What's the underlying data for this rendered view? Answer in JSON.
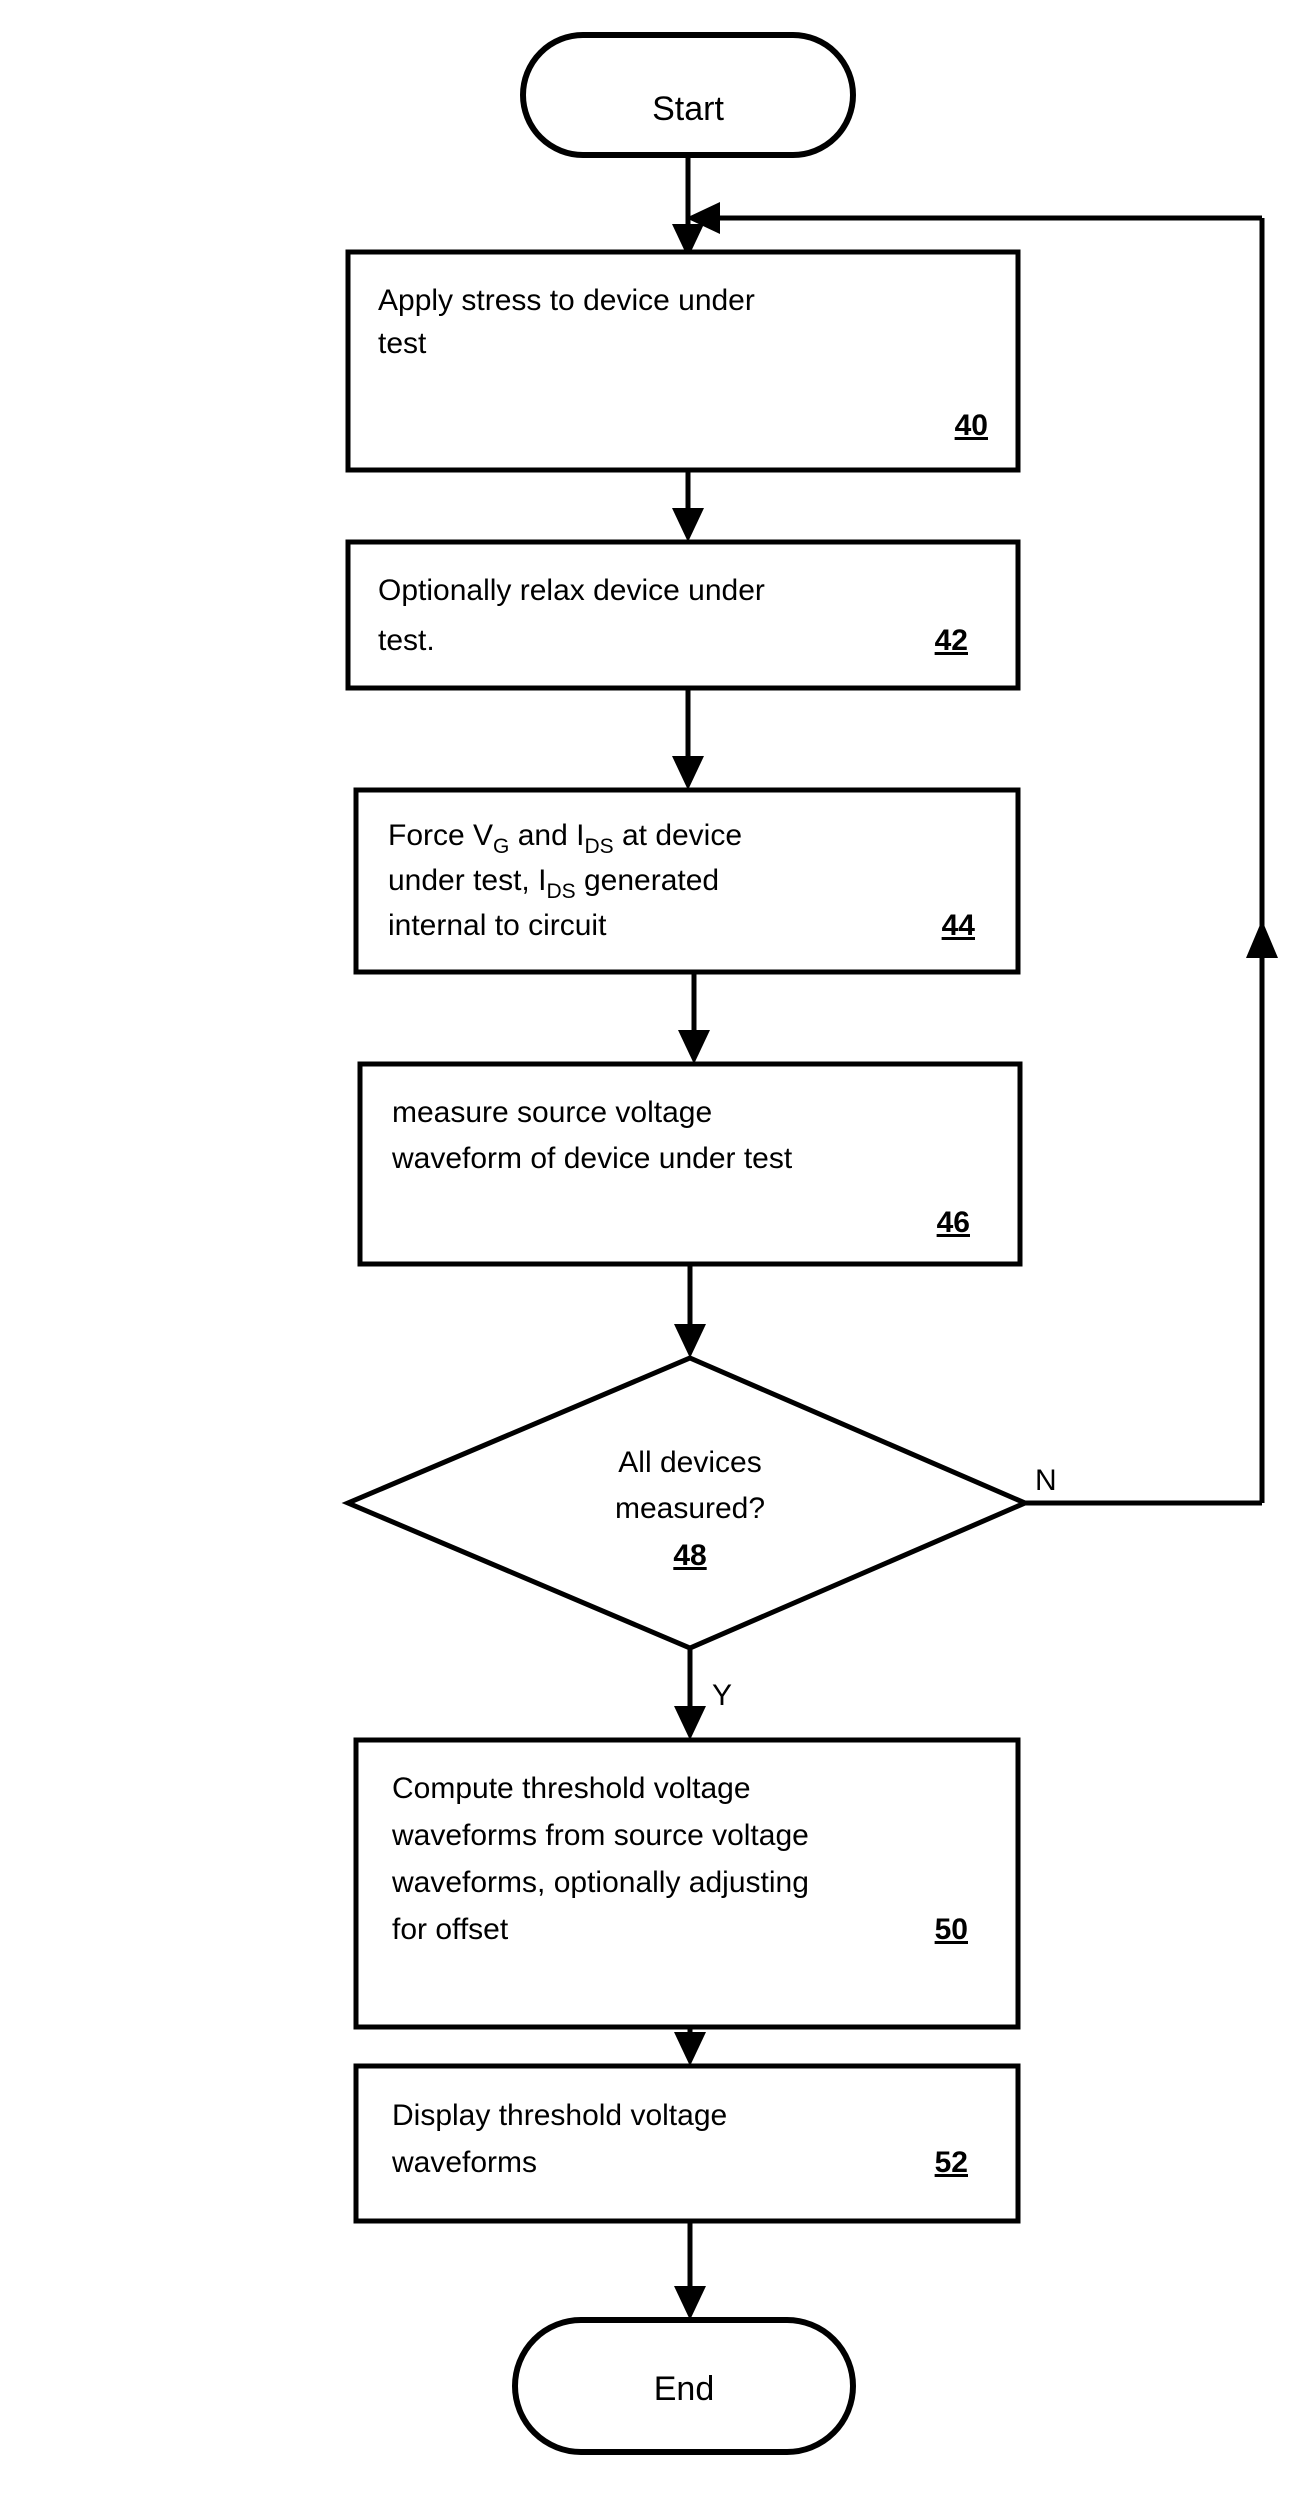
{
  "diagram": {
    "title": "Threshold voltage waveform measurement flowchart",
    "colors": {
      "stroke": "#000000",
      "fill": "#ffffff",
      "background": "#ffffff"
    },
    "start": {
      "label": "Start"
    },
    "end": {
      "label": "End"
    },
    "steps": [
      {
        "ref": "40",
        "lines": [
          "Apply stress to device under",
          "test"
        ],
        "line1": "Apply stress to device under",
        "line2": "test",
        "line3": "",
        "line4": "",
        "full_text": "Apply stress to device under test"
      },
      {
        "ref": "42",
        "lines": [
          "Optionally relax device under",
          "test."
        ],
        "line1": "Optionally relax device under",
        "line2": "test.",
        "line3": "",
        "line4": "",
        "full_text": "Optionally relax device under test."
      },
      {
        "ref": "44",
        "lines": [
          "Force VG and IDS  at device",
          "under test,  IDS generated",
          "internal to circuit"
        ],
        "line1_a": "Force V",
        "line1_sub1": "G",
        "line1_b": " and I",
        "line1_sub2": "DS",
        "line1_c": "  at device",
        "line2_a": "under test,  I",
        "line2_sub1": "DS",
        "line2_b": " generated",
        "line3": "internal to circuit",
        "full_text": "Force VG and IDS at device under test, IDS generated internal to circuit"
      },
      {
        "ref": "46",
        "lines": [
          "measure source voltage",
          "waveform of device under test"
        ],
        "line1": "measure source voltage",
        "line2": "waveform of device under test",
        "line3": "",
        "line4": "",
        "full_text": "measure source voltage waveform of device under test"
      },
      {
        "ref": "50",
        "lines": [
          "Compute threshold voltage",
          "waveforms from source voltage",
          "waveforms, optionally adjusting",
          "for offset"
        ],
        "line1": "Compute threshold voltage",
        "line2": "waveforms from source voltage",
        "line3": "waveforms, optionally adjusting",
        "line4": "for offset",
        "full_text": "Compute threshold voltage waveforms from source voltage waveforms, optionally adjusting for offset"
      },
      {
        "ref": "52",
        "lines": [
          "Display threshold voltage",
          "waveforms"
        ],
        "line1": "Display threshold voltage",
        "line2": "waveforms",
        "line3": "",
        "line4": "",
        "full_text": "Display threshold voltage waveforms"
      }
    ],
    "decision": {
      "ref": "48",
      "line1": "All devices",
      "line2": "measured?",
      "full_text": "All devices measured?",
      "branch_no": "N",
      "branch_yes": "Y"
    }
  }
}
